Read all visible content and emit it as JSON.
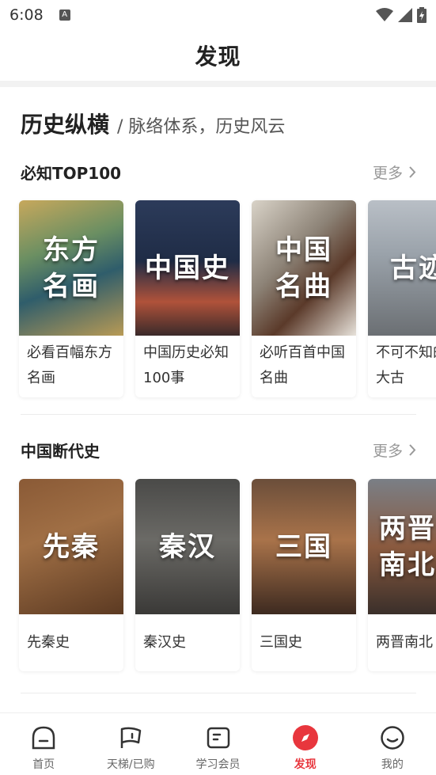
{
  "status": {
    "time": "6:08",
    "notif": "A"
  },
  "header": {
    "title": "发现"
  },
  "section": {
    "title": "历史纵横",
    "subtitle": "/ 脉络体系，历史风云"
  },
  "groups": [
    {
      "title": "必知TOP100",
      "more": "更多",
      "cards": [
        {
          "image_text": "东方\n名画",
          "caption": "必看百幅东方名画"
        },
        {
          "image_text": "中国史",
          "caption": "中国历史必知100事"
        },
        {
          "image_text": "中国\n名曲",
          "caption": "必听百首中国名曲"
        },
        {
          "image_text": "古迹",
          "caption": "不可不知的百大古"
        }
      ]
    },
    {
      "title": "中国断代史",
      "more": "更多",
      "cards": [
        {
          "image_text": "先秦",
          "caption": "先秦史"
        },
        {
          "image_text": "秦汉",
          "caption": "秦汉史"
        },
        {
          "image_text": "三国",
          "caption": "三国史"
        },
        {
          "image_text": "两晋\n南北",
          "caption": "两晋南北"
        }
      ]
    }
  ],
  "nav": [
    {
      "label": "首页",
      "icon": "home-icon"
    },
    {
      "label": "天梯/已购",
      "icon": "flag-icon"
    },
    {
      "label": "学习会员",
      "icon": "book-icon"
    },
    {
      "label": "发现",
      "icon": "compass-icon"
    },
    {
      "label": "我的",
      "icon": "smile-icon"
    }
  ],
  "colors": {
    "accent": "#e8363d",
    "text": "#222222",
    "muted": "#999999"
  }
}
